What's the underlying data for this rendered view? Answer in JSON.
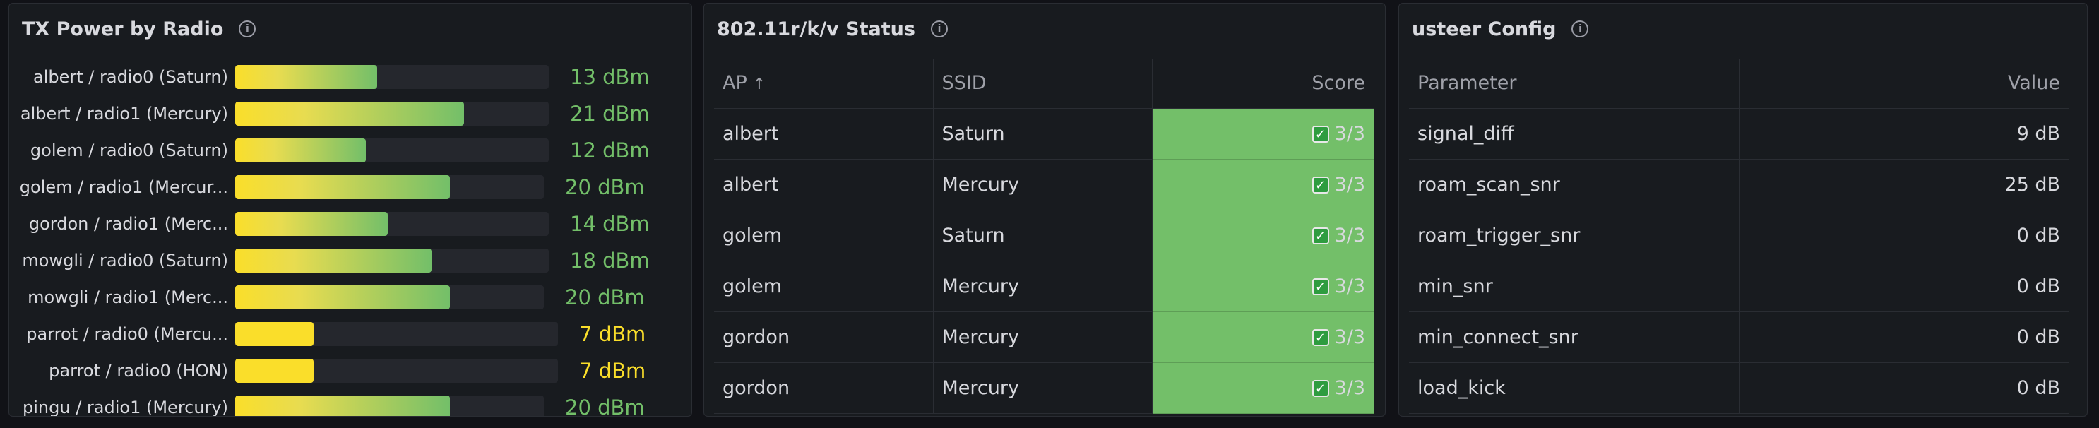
{
  "tx_panel": {
    "title": "TX Power by Radio",
    "max": 40,
    "rows": [
      {
        "label": "albert / radio0 (Saturn)",
        "value": 13,
        "unit": "dBm"
      },
      {
        "label": "albert / radio1 (Mercury)",
        "value": 21,
        "unit": "dBm"
      },
      {
        "label": "golem / radio0 (Saturn)",
        "value": 12,
        "unit": "dBm"
      },
      {
        "label": "golem / radio1 (Mercur...",
        "value": 20,
        "unit": "dBm"
      },
      {
        "label": "gordon / radio1 (Merc...",
        "value": 14,
        "unit": "dBm"
      },
      {
        "label": "mowgli / radio0 (Saturn)",
        "value": 18,
        "unit": "dBm"
      },
      {
        "label": "mowgli / radio1 (Merc...",
        "value": 20,
        "unit": "dBm"
      },
      {
        "label": "parrot / radio0 (Mercu...",
        "value": 7,
        "unit": "dBm"
      },
      {
        "label": "parrot / radio0 (HON)",
        "value": 7,
        "unit": "dBm"
      },
      {
        "label": "pingu / radio1 (Mercury)",
        "value": 20,
        "unit": "dBm"
      }
    ]
  },
  "status_panel": {
    "title": "802.11r/k/v Status",
    "columns": {
      "ap": "AP",
      "ssid": "SSID",
      "score": "Score"
    },
    "sort_icon": "arrow-up-icon",
    "rows": [
      {
        "ap": "albert",
        "ssid": "Saturn",
        "score": "3/3"
      },
      {
        "ap": "albert",
        "ssid": "Mercury",
        "score": "3/3"
      },
      {
        "ap": "golem",
        "ssid": "Saturn",
        "score": "3/3"
      },
      {
        "ap": "golem",
        "ssid": "Mercury",
        "score": "3/3"
      },
      {
        "ap": "gordon",
        "ssid": "Mercury",
        "score": "3/3"
      },
      {
        "ap": "gordon",
        "ssid": "Mercury",
        "score": "3/3"
      }
    ]
  },
  "usteer_panel": {
    "title": "usteer Config",
    "columns": {
      "param": "Parameter",
      "value": "Value"
    },
    "rows": [
      {
        "param": "signal_diff",
        "value": "9 dB"
      },
      {
        "param": "roam_scan_snr",
        "value": "25 dB"
      },
      {
        "param": "roam_trigger_snr",
        "value": "0 dB"
      },
      {
        "param": "min_snr",
        "value": "0 dB"
      },
      {
        "param": "min_connect_snr",
        "value": "0 dB"
      },
      {
        "param": "load_kick",
        "value": "0 dB"
      }
    ]
  },
  "colors": {
    "green": "#73bf69",
    "yellow": "#fade2a",
    "panel": "#181b1f"
  }
}
